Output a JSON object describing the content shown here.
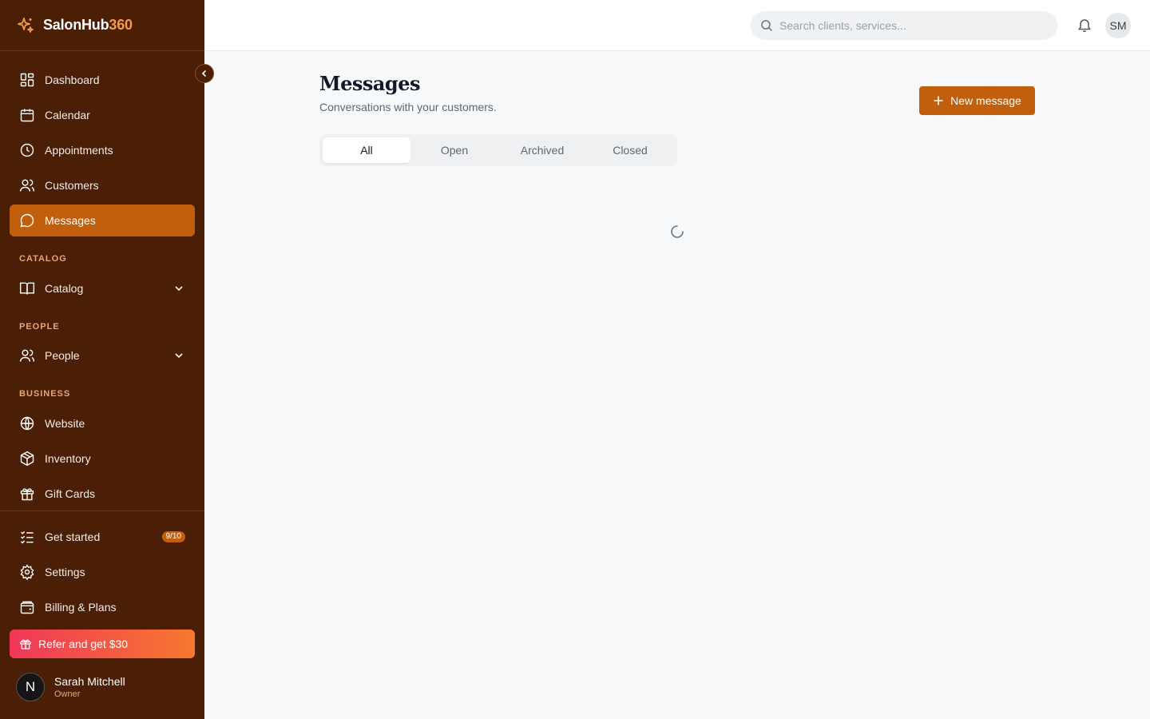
{
  "brand": {
    "name": "SalonHub",
    "suffix": "360"
  },
  "sidebar": {
    "main_items": [
      {
        "label": "Dashboard",
        "icon": "dashboard-icon"
      },
      {
        "label": "Calendar",
        "icon": "calendar-icon"
      },
      {
        "label": "Appointments",
        "icon": "clock-icon"
      },
      {
        "label": "Customers",
        "icon": "users-icon"
      },
      {
        "label": "Messages",
        "icon": "message-icon",
        "active": true
      }
    ],
    "sections": {
      "catalog": {
        "label": "CATALOG",
        "item": "Catalog"
      },
      "people": {
        "label": "PEOPLE",
        "item": "People"
      },
      "business": {
        "label": "BUSINESS",
        "items": [
          "Website",
          "Inventory",
          "Gift Cards"
        ]
      }
    },
    "bottom_items": {
      "get_started": "Get started",
      "get_started_badge": "9/10",
      "settings": "Settings",
      "billing": "Billing & Plans"
    },
    "refer_label": "Refer and get $30",
    "user": {
      "initial": "N",
      "name": "Sarah Mitchell",
      "role": "Owner"
    }
  },
  "header": {
    "search_placeholder": "Search clients, services...",
    "avatar_initials": "SM"
  },
  "main": {
    "title": "Messages",
    "subtitle": "Conversations with your customers.",
    "new_button_label": "New message",
    "tabs": [
      "All",
      "Open",
      "Archived",
      "Closed"
    ],
    "active_tab": "All"
  },
  "colors": {
    "sidebar_bg": "#4a1f06",
    "accent": "#c25f0c",
    "brand_accent": "#f39a4c",
    "refer_gradient_start": "#f0375a",
    "refer_gradient_end": "#f7782e"
  }
}
